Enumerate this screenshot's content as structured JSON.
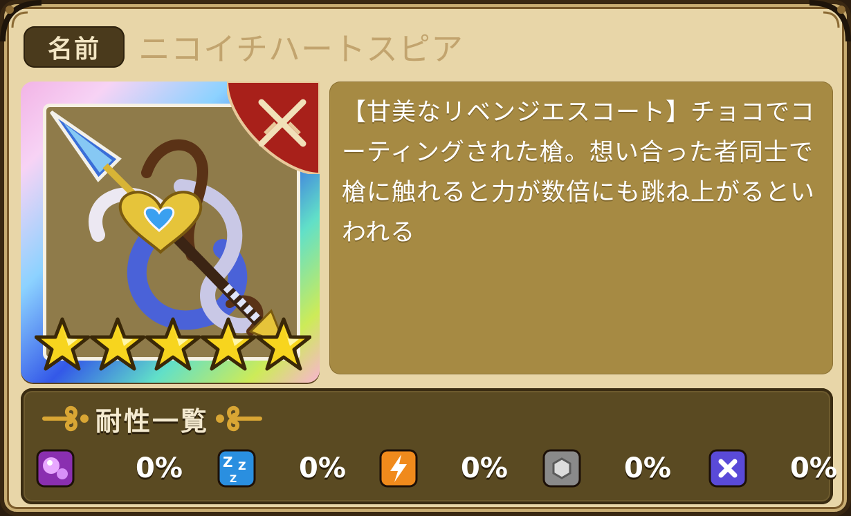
{
  "name_label": "名前",
  "item_name": "ニコイチハートスピア",
  "description": "【甘美なリベンジエスコート】チョコでコーティングされた槍。想い合った者同士で槍に触れると力が数倍にも跳ね上がるといわれる",
  "rarity_stars": 5,
  "weapon_type_icon": "crossed-swords-icon",
  "resistance": {
    "title": "耐性一覧",
    "items": [
      {
        "icon": "poison-icon",
        "value": "0%"
      },
      {
        "icon": "sleep-icon",
        "value": "0%"
      },
      {
        "icon": "paralysis-icon",
        "value": "0%"
      },
      {
        "icon": "petrify-icon",
        "value": "0%"
      },
      {
        "icon": "seal-icon",
        "value": "0%"
      }
    ]
  },
  "colors": {
    "panel_bg": "#e8d6a8",
    "desc_bg": "#a68a43",
    "resist_bg": "#5a4a22",
    "badge_red": "#a8201a"
  }
}
